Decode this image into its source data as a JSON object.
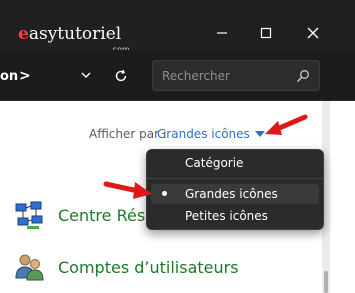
{
  "watermark": {
    "brand": "easytutoriel",
    "first_letter": "e",
    "rest": "asytutoriel",
    "domain": ".com"
  },
  "window": {
    "buttons": [
      "minimize",
      "maximize",
      "close"
    ]
  },
  "navbar": {
    "breadcrumb": "on",
    "breadcrumb_separator": ">",
    "search_placeholder": "Rechercher"
  },
  "view": {
    "label": "Afficher par :",
    "value": "Grandes icônes"
  },
  "menu": {
    "items": [
      {
        "label": "Catégorie",
        "selected": false
      },
      {
        "label": "Grandes icônes",
        "selected": true
      },
      {
        "label": "Petites icônes",
        "selected": false
      }
    ]
  },
  "items": [
    {
      "label": "Centre Résea",
      "icon": "network-center-icon"
    },
    {
      "label": "Comptes d’utilisateurs",
      "icon": "user-accounts-icon"
    }
  ],
  "colors": {
    "accent": "#2a6fd0",
    "link_green": "#1e7a2a",
    "arrow_red": "#e01818",
    "logo_red": "#ff3a3a"
  }
}
